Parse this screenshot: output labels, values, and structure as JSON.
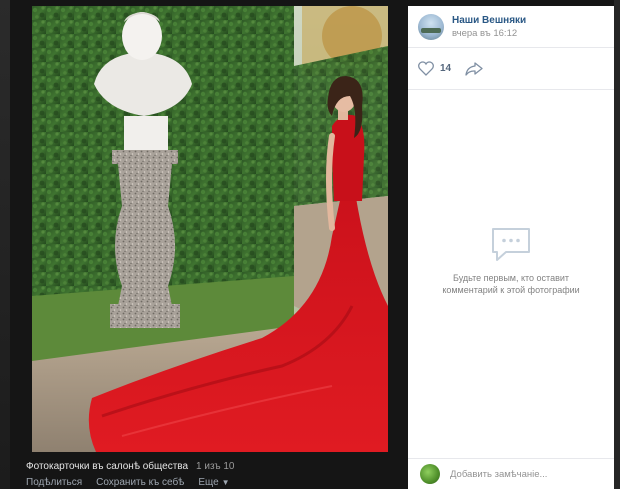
{
  "post": {
    "group_name": "Наши Вешняки",
    "time": "вчера въ 16:12",
    "likes": "14"
  },
  "comments": {
    "empty_line1": "Будьте первым, кто оставит",
    "empty_line2": "комментарий к этой фотографии",
    "input_placeholder": "Добавить замѣчаніе..."
  },
  "album": {
    "title": "Фотокарточки въ салонѣ общества",
    "counter": "1 изъ 10"
  },
  "actions": {
    "share": "Подѣлиться",
    "save": "Сохранить къ себѣ",
    "more": "Еще"
  },
  "icons": {
    "like": "heart-icon",
    "share": "share-arrow-icon",
    "empty": "comment-bubble-icon",
    "more": "chevron-down-icon"
  },
  "colors": {
    "link": "#2a5885",
    "muted": "#939393",
    "dress": "#d8141a"
  }
}
